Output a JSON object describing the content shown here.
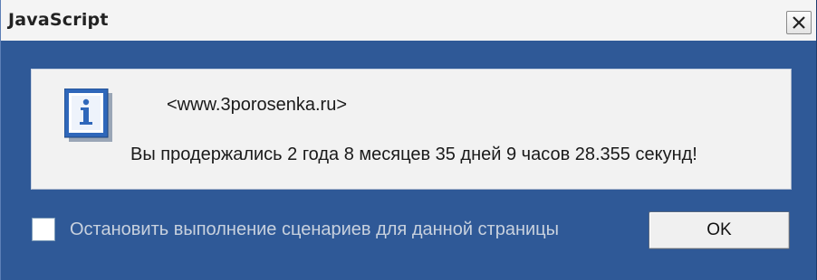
{
  "window": {
    "title": "JavaScript",
    "close_icon": "close-icon"
  },
  "message": {
    "icon": "info-icon",
    "site": "<www.3porosenka.ru>",
    "text": "Вы продержались 2 года 8 месяцев 35 дней 9 часов 28.355 секунд!"
  },
  "options": {
    "suppress_checkbox_checked": false,
    "suppress_label": "Остановить выполнение сценариев для данной страницы"
  },
  "buttons": {
    "ok_label": "OK"
  },
  "colors": {
    "frame": "#2f5997",
    "panel": "#f2f2f2",
    "titlebar": "#f4f4f4",
    "disabled_label": "#c8d1de"
  }
}
